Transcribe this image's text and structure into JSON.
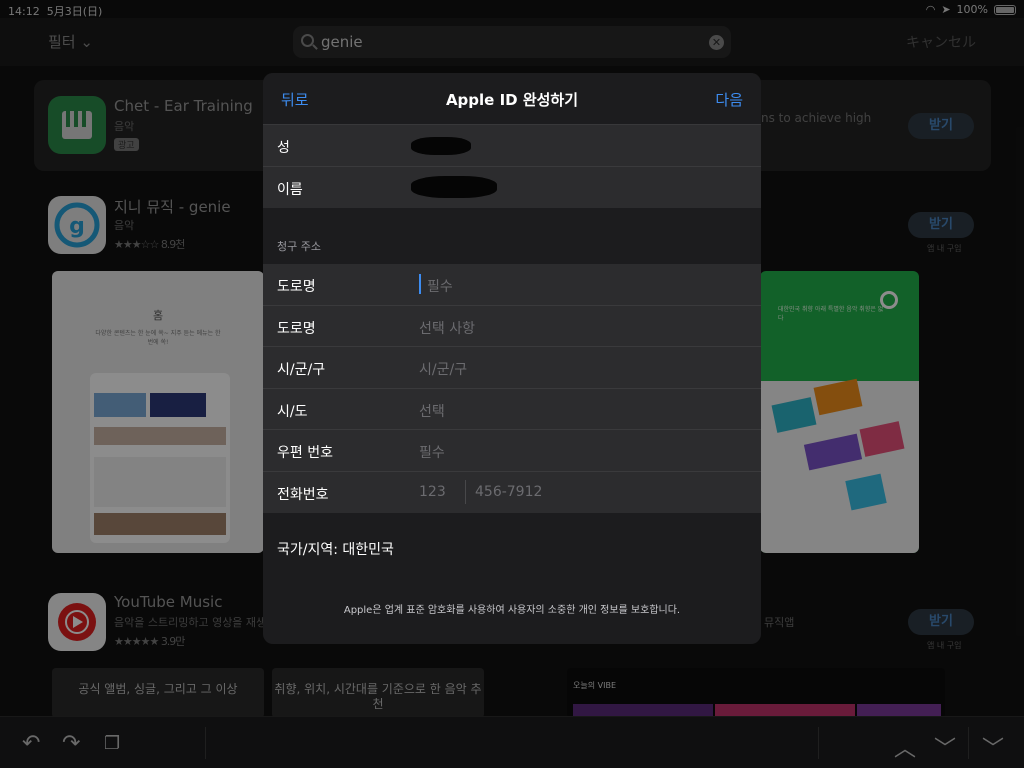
{
  "status": {
    "time": "14:12",
    "date": "5月3日(日)",
    "battery": "100%"
  },
  "search": {
    "filter_label": "필터",
    "query": "genie",
    "cancel_label": "キャンセル"
  },
  "apps": [
    {
      "title": "Chet - Ear Training",
      "category": "음악",
      "badge": "광고",
      "description": "ns to achieve high",
      "get": "받기"
    },
    {
      "title": "지니 뮤직 - genie",
      "category": "음악",
      "rating_count": "8.9천",
      "get": "받기",
      "iap": "앱 내 구입",
      "shot_left_title": "홈",
      "shot_left_sub": "다양한 콘텐츠는 한 눈에 쏙~ 지주 듣는 메뉴는 한 번에 쏙!",
      "shot_right_text": "대한민국 취향 아래 특별한 음악 취향은 없다"
    },
    {
      "title": "YouTube Music",
      "description": "음악을 스트리밍하고 영상을 재생",
      "rating_count": "3.9만",
      "get": "받기",
      "iap": "앱 내 구입",
      "right_text": "뮤직앱"
    }
  ],
  "tiles": [
    "공식 앨범, 싱글, 그리고 그 이상",
    "취향, 위치, 시간대를 기준으로 한 음악 추천"
  ],
  "tile3": "오늘의 VIBE",
  "sheet": {
    "back": "뒤로",
    "title": "Apple ID 완성하기",
    "next": "다음",
    "name_rows": [
      {
        "label": "성"
      },
      {
        "label": "이름"
      }
    ],
    "billing_header": "청구 주소",
    "address_rows": [
      {
        "label": "도로명",
        "placeholder": "필수"
      },
      {
        "label": "도로명",
        "placeholder": "선택 사항"
      },
      {
        "label": "시/군/구",
        "placeholder": "시/군/구"
      },
      {
        "label": "시/도",
        "placeholder": "선택"
      },
      {
        "label": "우편 번호",
        "placeholder": "필수"
      },
      {
        "label": "전화번호",
        "placeholder": "123",
        "placeholder2": "456-7912"
      }
    ],
    "country": "국가/지역: 대한민국",
    "privacy": "Apple은 업계 표준 암호화를 사용하여 사용자의 소중한 개인 정보를 보호합니다."
  },
  "colors": {
    "accent": "#3d8cf0",
    "sheet_bg": "#1c1c1e",
    "row_bg": "#2c2c2e"
  }
}
